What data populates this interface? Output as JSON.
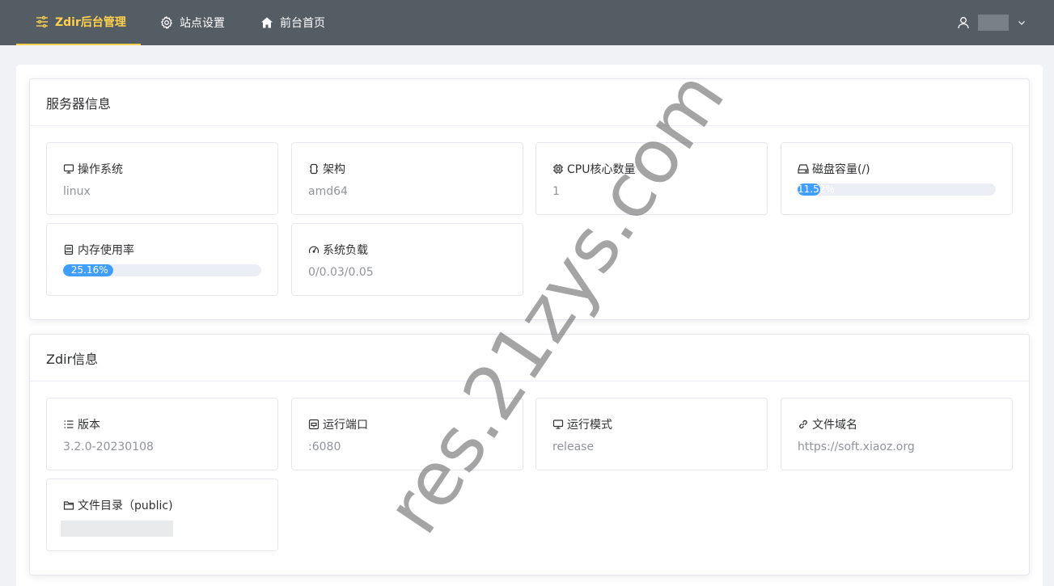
{
  "nav": {
    "brand": "Zdir后台管理",
    "settings": "站点设置",
    "home": "前台首页",
    "accent_color": "#ffd04b",
    "bar_color": "#545c64"
  },
  "server": {
    "title": "服务器信息",
    "os": {
      "label": "操作系统",
      "value": "linux"
    },
    "arch": {
      "label": "架构",
      "value": "amd64"
    },
    "cpu": {
      "label": "CPU核心数量",
      "value": "1"
    },
    "disk": {
      "label": "磁盘容量(/)",
      "percent_text": "11.52%",
      "percent": 11.52
    },
    "memory": {
      "label": "内存使用率",
      "percent_text": "25.16%",
      "percent": 25.16
    },
    "load": {
      "label": "系统负载",
      "value": "0/0.03/0.05"
    }
  },
  "zdir": {
    "title": "Zdir信息",
    "version": {
      "label": "版本",
      "value": "3.2.0-20230108"
    },
    "port": {
      "label": "运行端口",
      "value": ":6080"
    },
    "mode": {
      "label": "运行模式",
      "value": "release"
    },
    "domain": {
      "label": "文件域名",
      "value": "https://soft.xiaoz.org"
    },
    "dir": {
      "label": "文件目录（public)"
    }
  },
  "watermark": "res.21zys.com"
}
